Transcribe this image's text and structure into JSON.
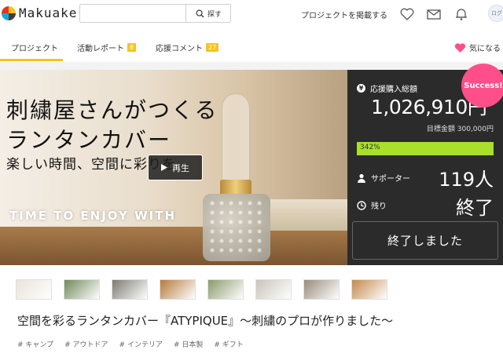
{
  "header": {
    "brand": "Makuake",
    "search_placeholder": "",
    "search_button": "探す",
    "post_link": "プロジェクトを掲載する",
    "avatar_label": "ログ",
    "logo_colors": [
      "#e5322d",
      "#f5c518",
      "#1ba6d9",
      "#3d3d3d"
    ]
  },
  "tabs": [
    {
      "label": "プロジェクト",
      "active": true
    },
    {
      "label": "活動レポート",
      "count": "8"
    },
    {
      "label": "応援コメント",
      "count": "27"
    }
  ],
  "favorite_label": "気になる",
  "hero": {
    "title_line1": "刺繍屋さんがつくる",
    "title_line2": "ランタンカバー",
    "subtitle": "楽しい時間、空間に彩りを",
    "english": "TIME TO ENJOY WITH",
    "play_label": "再生"
  },
  "panel": {
    "amount_label": "応援購入総額",
    "amount": "1,026,910円",
    "goal": "目標金額 300,000円",
    "progress_text": "342%",
    "progress_fraction": 1.0,
    "supporters_label": "サポーター",
    "supporters_value": "119人",
    "remaining_label": "残り",
    "remaining_value": "終了",
    "ended_button": "終了しました",
    "success_badge": "Success!",
    "accent_color": "#a8e02a",
    "badge_color": "#ff4f8a"
  },
  "thumbnails": [
    "#e9e3da",
    "#6f8a5a",
    "#7d7a70",
    "#b77a3a",
    "#8a9a6a",
    "#c8c4b8",
    "#9a8a7a",
    "#c4884a",
    "#5a4a3a"
  ],
  "project_title": "空間を彩るランタンカバー『ATYPIQUE』〜刺繍のプロが作りました〜",
  "tags": [
    "# キャンプ",
    "# アウトドア",
    "# インテリア",
    "# 日本製",
    "# ギフト"
  ]
}
